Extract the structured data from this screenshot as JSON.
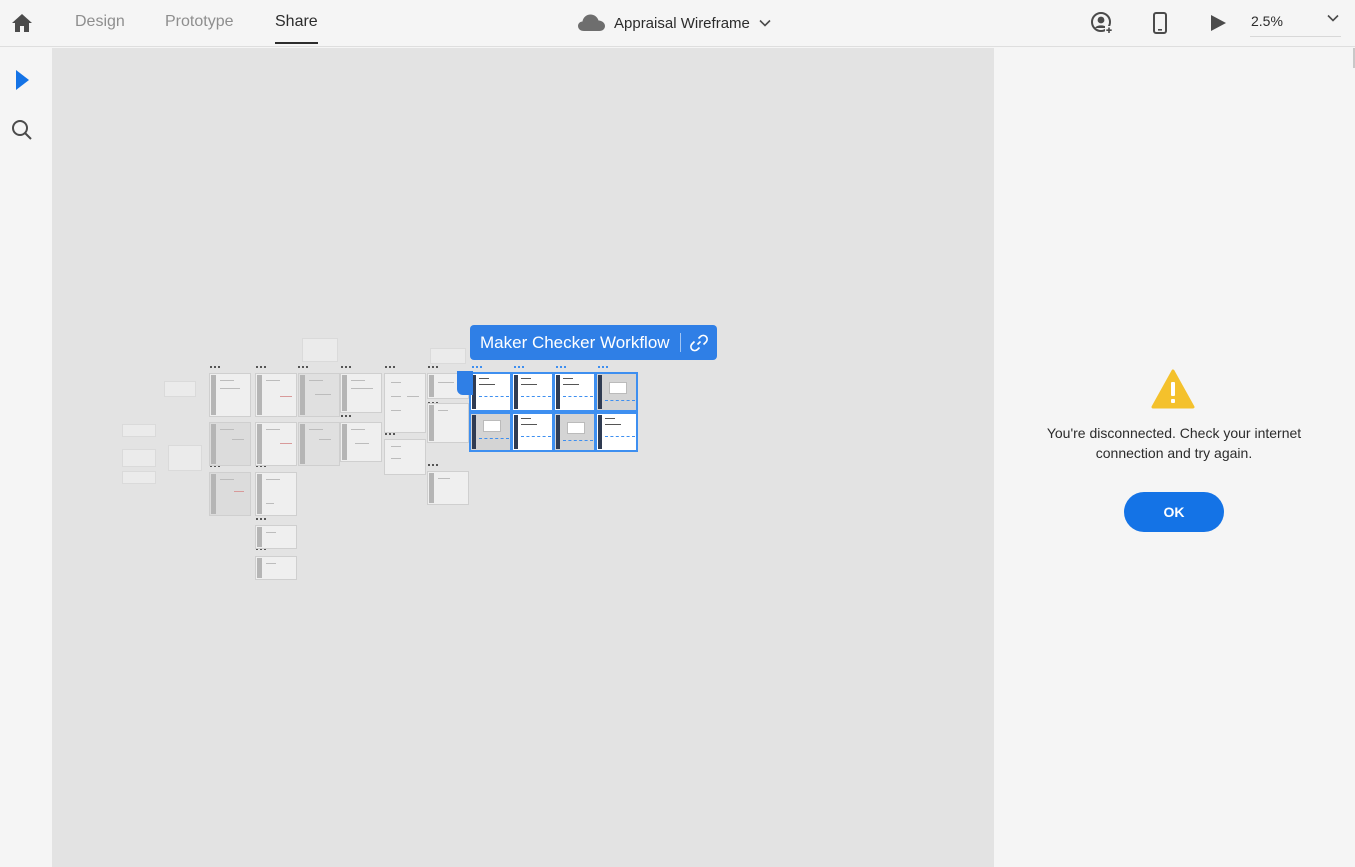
{
  "header": {
    "tabs": [
      {
        "label": "Design"
      },
      {
        "label": "Prototype"
      },
      {
        "label": "Share"
      }
    ],
    "active_tab": "Share",
    "document_title": "Appraisal Wireframe",
    "zoom": "2.5%",
    "icons": [
      "home-icon",
      "cloud-icon",
      "chevron-down-icon",
      "user-account-icon",
      "mobile-device-icon",
      "play-icon"
    ]
  },
  "toolbar": {
    "icons": [
      "select-arrow-icon",
      "search-icon"
    ]
  },
  "canvas": {
    "flow_label": "Maker Checker Workflow",
    "flow_label_icon": "link-icon"
  },
  "dialog": {
    "message": "You're disconnected. Check your internet connection and try again.",
    "ok_label": "OK",
    "icon": "warning-icon"
  },
  "colors": {
    "accent": "#1473e6",
    "flow_label_bg": "#2f7fe6",
    "warning": "#f4c12c",
    "canvas_bg": "#e3e3e3"
  }
}
